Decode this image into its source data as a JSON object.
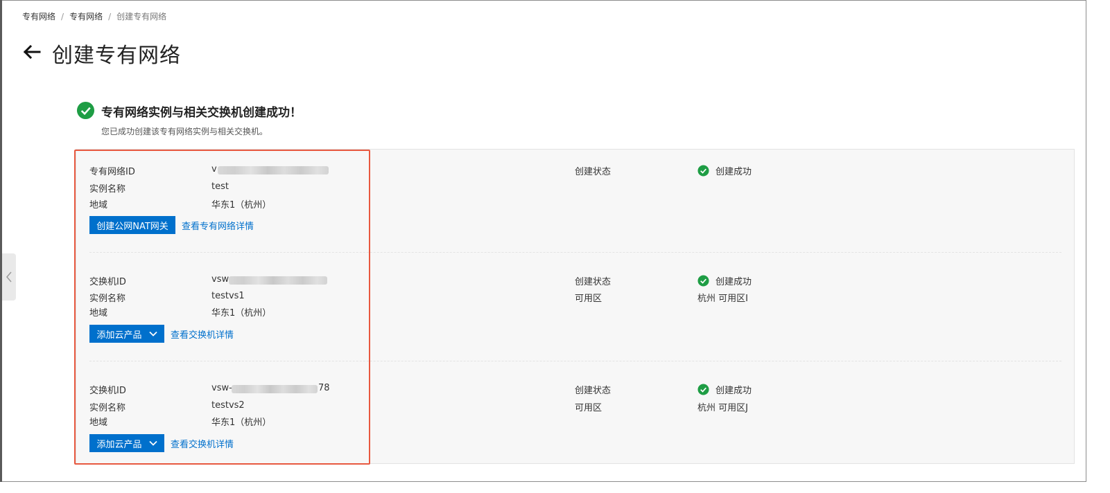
{
  "breadcrumb": {
    "item1": "专有网络",
    "item2": "专有网络",
    "current": "创建专有网络",
    "separator": "/"
  },
  "page": {
    "title": "创建专有网络"
  },
  "result": {
    "title": "专有网络实例与相关交换机创建成功！",
    "subtitle": "您已成功创建该专有网络实例与相关交换机。"
  },
  "vpc": {
    "id_label": "专有网络ID",
    "id_value": "v",
    "name_label": "实例名称",
    "name_value": "test",
    "region_label": "地域",
    "region_value": "华东1（杭州）",
    "status_label": "创建状态",
    "status_value": "创建成功",
    "primary_button": "创建公网NAT网关",
    "detail_link": "查看专有网络详情"
  },
  "vswitches": [
    {
      "id_label": "交换机ID",
      "id_prefix": "vsw",
      "id_suffix": "",
      "name_label": "实例名称",
      "name_value": "testvs1",
      "region_label": "地域",
      "region_value": "华东1（杭州）",
      "status_label": "创建状态",
      "status_value": "创建成功",
      "zone_label": "可用区",
      "zone_value": "杭州 可用区I",
      "add_button": "添加云产品",
      "detail_link": "查看交换机详情"
    },
    {
      "id_label": "交换机ID",
      "id_prefix": "vsw-",
      "id_suffix": "78",
      "name_label": "实例名称",
      "name_value": "testvs2",
      "region_label": "地域",
      "region_value": "华东1（杭州）",
      "status_label": "创建状态",
      "status_value": "创建成功",
      "zone_label": "可用区",
      "zone_value": "杭州 可用区J",
      "add_button": "添加云产品",
      "detail_link": "查看交换机详情"
    }
  ],
  "colors": {
    "primary": "#0070cc",
    "success": "#1e9d44",
    "highlight_border": "#e8583f",
    "panel_bg": "#f7f7f7"
  },
  "icons": {
    "back": "arrow-left-icon",
    "success": "check-circle-icon",
    "dropdown": "chevron-down-icon",
    "collapse": "chevron-left-icon"
  }
}
